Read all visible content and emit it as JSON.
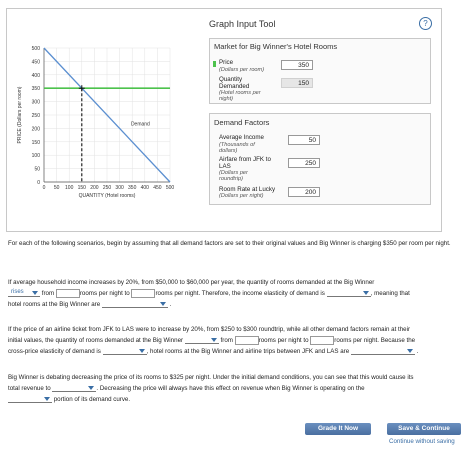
{
  "tool": {
    "title": "Graph Input Tool",
    "help": "?"
  },
  "market": {
    "title": "Market for Big Winner's Hotel Rooms",
    "price_label": "Price",
    "price_sub": "(Dollars per room)",
    "price_value": "350",
    "qty_label": "Quantity Demanded",
    "qty_sub": "(Hotel rooms per night)",
    "qty_value": "150"
  },
  "factors": {
    "title": "Demand Factors",
    "income_label": "Average Income",
    "income_sub": "(Thousands of dollars)",
    "income_value": "50",
    "airfare_label": "Airfare from JFK to LAS",
    "airfare_sub": "(Dollars per roundtrip)",
    "airfare_value": "250",
    "lucky_label": "Room Rate at Lucky",
    "lucky_sub": "(Dollars per night)",
    "lucky_value": "200"
  },
  "chart_data": {
    "type": "line",
    "xlabel": "QUANTITY (Hotel rooms)",
    "ylabel": "PRICE (Dollars per room)",
    "xlim": [
      0,
      500
    ],
    "ylim": [
      0,
      500
    ],
    "xticks": [
      0,
      50,
      100,
      150,
      200,
      250,
      300,
      350,
      400,
      450,
      500
    ],
    "yticks": [
      0,
      50,
      100,
      150,
      200,
      250,
      300,
      350,
      400,
      450,
      500
    ],
    "series": [
      {
        "name": "Demand",
        "points": [
          [
            0,
            500
          ],
          [
            500,
            0
          ]
        ]
      }
    ],
    "reference_price": 350,
    "reference_quantity": 150
  },
  "q_intro": "For each of the following scenarios, begin by assuming that all demand factors are set to their original values and Big Winner is charging $350 per room per night.",
  "q1": {
    "text1": "If average household income increases by 20%, from $50,000 to $60,000 per year, the quantity of rooms demanded at the Big Winner",
    "dd1": "rises",
    "text2": "from",
    "text3": "rooms per night to",
    "text4": "rooms per night. Therefore, the income elasticity of demand is",
    "text5": ", meaning that",
    "text6": "hotel rooms at the Big Winner are",
    "text7": "."
  },
  "q2": {
    "text1": "If the price of an airline ticket from JFK to LAS were to increase by 20%, from $250 to $300 roundtrip, while all other demand factors remain at their",
    "text2": "initial values, the quantity of rooms demanded at the Big Winner",
    "text3": "from",
    "text4": "rooms per night to",
    "text5": "rooms per night. Because the",
    "text6": "cross-price elasticity of demand is",
    "text7": ", hotel rooms at the Big Winner and airline trips between JFK and LAS are",
    "text8": "."
  },
  "q3": {
    "text1": "Big Winner is debating decreasing the price of its rooms to $325 per night. Under the initial demand conditions, you can see that this would cause its",
    "text2": "total revenue to",
    "text3": ". Decreasing the price will always have this effect on revenue when Big Winner is operating on the",
    "text4": "portion of its demand curve."
  },
  "buttons": {
    "grade": "Grade It Now",
    "save": "Save & Continue",
    "continue": "Continue without saving"
  }
}
